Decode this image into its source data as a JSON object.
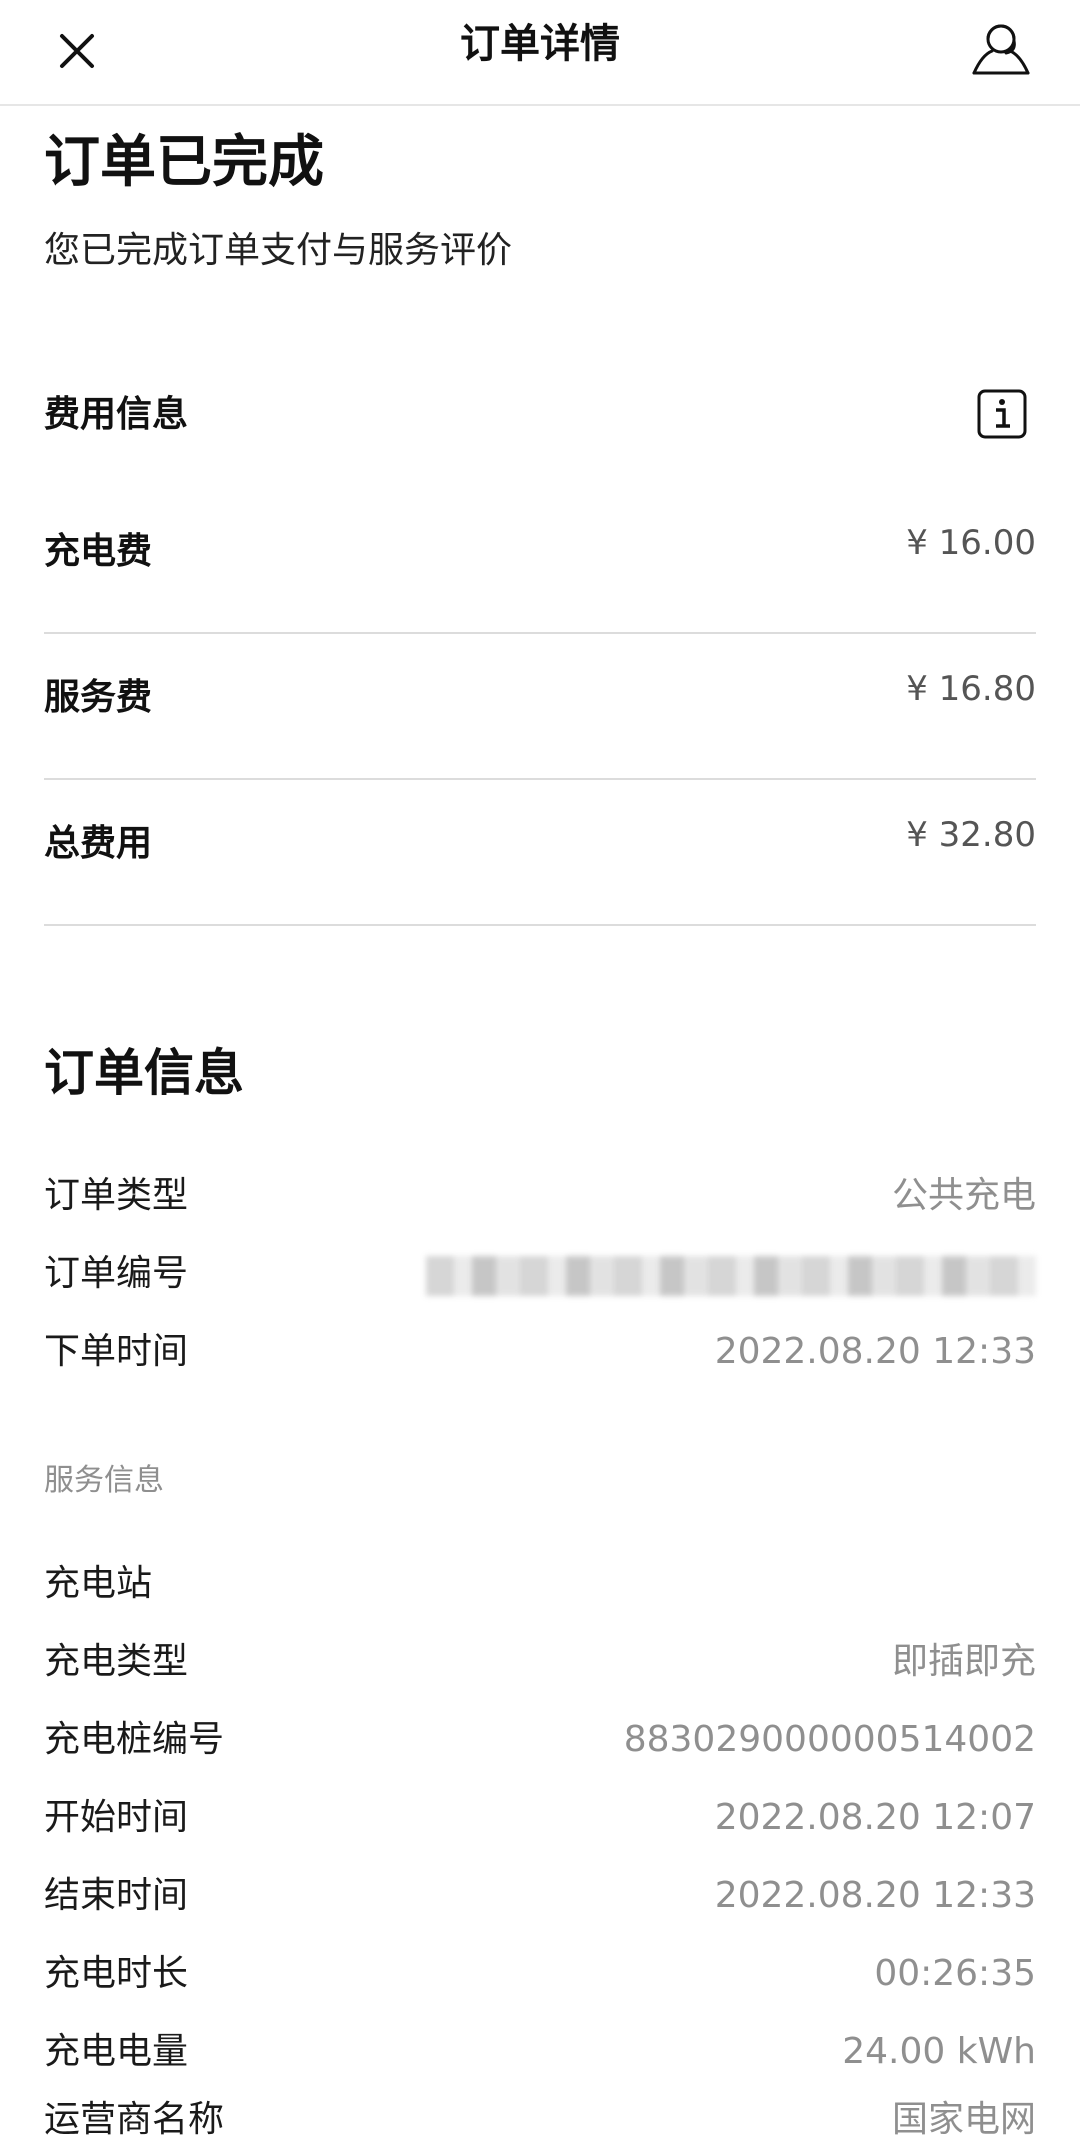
{
  "header": {
    "title": "订单详情"
  },
  "status": {
    "title": "订单已完成",
    "subtitle": "您已完成订单支付与服务评价"
  },
  "fees": {
    "heading": "费用信息",
    "items": [
      {
        "label": "充电费",
        "value": "¥ 16.00"
      },
      {
        "label": "服务费",
        "value": "¥ 16.80"
      },
      {
        "label": "总费用",
        "value": "¥ 32.80"
      }
    ]
  },
  "order_info": {
    "heading": "订单信息",
    "rows": [
      {
        "label": "订单类型",
        "value": "公共充电"
      },
      {
        "label": "订单编号",
        "value": ""
      },
      {
        "label": "下单时间",
        "value": "2022.08.20 12:33"
      }
    ]
  },
  "service_info": {
    "heading": "服务信息",
    "rows": [
      {
        "label": "充电站",
        "value": ""
      },
      {
        "label": "充电类型",
        "value": "即插即充"
      },
      {
        "label": "充电桩编号",
        "value": "883029000000514002"
      },
      {
        "label": "开始时间",
        "value": "2022.08.20 12:07"
      },
      {
        "label": "结束时间",
        "value": "2022.08.20 12:33"
      },
      {
        "label": "充电时长",
        "value": "00:26:35"
      },
      {
        "label": "充电电量",
        "value": "24.00 kWh"
      },
      {
        "label": "运营商名称",
        "value": "国家电网"
      }
    ]
  },
  "icons": {
    "close": "close-icon",
    "support": "customer-service-icon",
    "info": "info-icon"
  }
}
